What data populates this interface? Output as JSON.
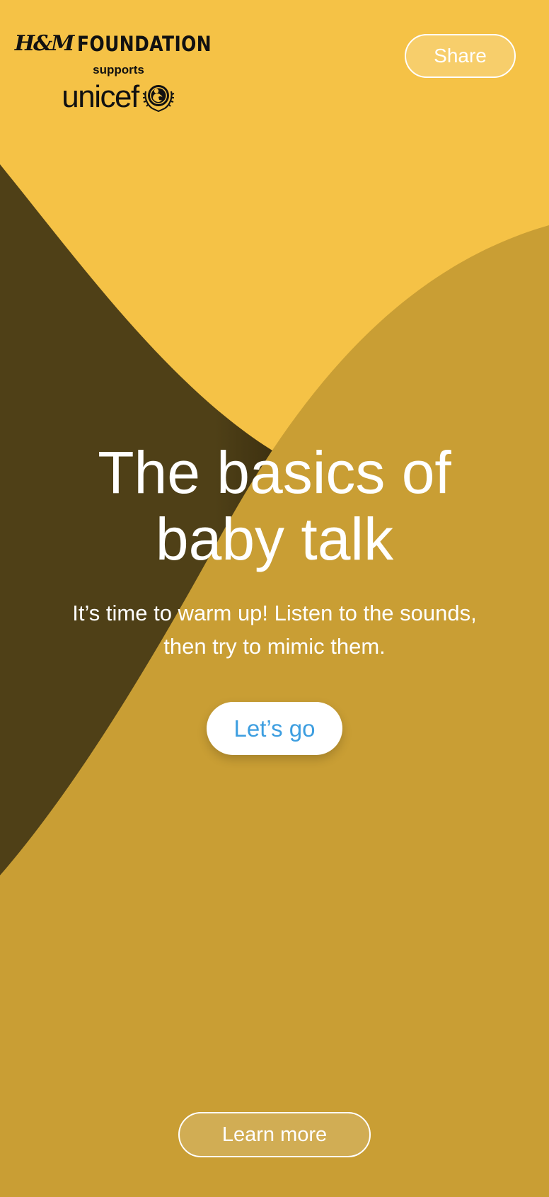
{
  "header": {
    "brand_mark": "H&M",
    "brand_name": "FOUNDATION",
    "supports_text": "supports",
    "partner_name": "unicef",
    "share_label": "Share"
  },
  "hero": {
    "title_line1": "The basics of",
    "title_line2": "baby talk",
    "subtitle_line1": "It’s time to warm up! Listen to the sounds,",
    "subtitle_line2": "then try to mimic them.",
    "cta_label": "Let’s go"
  },
  "footer": {
    "learn_more_label": "Learn more"
  },
  "colors": {
    "background_yellow": "#f5c246",
    "mustard_shape": "#c99e34",
    "dark_shape": "#4e3f17",
    "cta_text": "#3d9ee0",
    "text_white": "#ffffff"
  },
  "icons": {
    "unicef_emblem": "unicef-emblem-icon"
  }
}
